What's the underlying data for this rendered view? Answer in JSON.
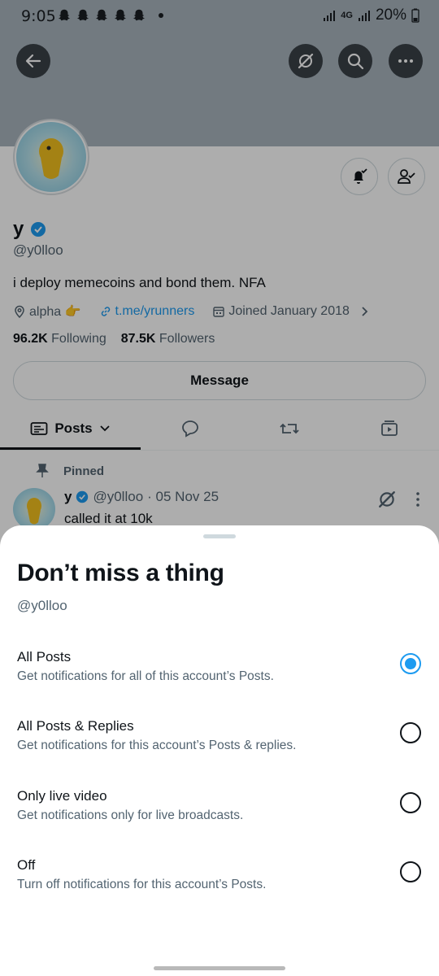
{
  "status_bar": {
    "time": "9:05",
    "network": "4G",
    "battery": "20%"
  },
  "header": {
    "icons": [
      "back-arrow-icon",
      "grok-icon",
      "search-icon",
      "more-icon"
    ]
  },
  "profile": {
    "name": "y",
    "handle": "@y0lloo",
    "bio": "i deploy memecoins and bond them. NFA",
    "location": "alpha 👉",
    "link": "t.me/yrunners",
    "joined": "Joined January 2018",
    "following_count": "96.2K",
    "following_label": "Following",
    "followers_count": "87.5K",
    "followers_label": "Followers",
    "message_label": "Message"
  },
  "tabs": {
    "posts_label": "Posts",
    "icons": [
      "posts-icon",
      "replies-icon",
      "reposts-icon",
      "media-icon"
    ]
  },
  "pinned_post": {
    "pinned_label": "Pinned",
    "author": "y",
    "handle": "@y0lloo",
    "date": "· 05 Nov 25",
    "text": "called it at 10k"
  },
  "sheet": {
    "title": "Don’t miss a thing",
    "handle": "@y0lloo",
    "options": [
      {
        "title": "All Posts",
        "subtitle": "Get notifications for all of this account’s Posts.",
        "selected": true
      },
      {
        "title": "All Posts & Replies",
        "subtitle": "Get notifications for this account’s Posts & replies.",
        "selected": false
      },
      {
        "title": "Only live video",
        "subtitle": "Get notifications only for live broadcasts.",
        "selected": false
      },
      {
        "title": "Off",
        "subtitle": "Turn off notifications for this account’s Posts.",
        "selected": false
      }
    ]
  },
  "colors": {
    "accent": "#1d9bf0",
    "banner": "#a8b4bd",
    "text_secondary": "#536471"
  }
}
